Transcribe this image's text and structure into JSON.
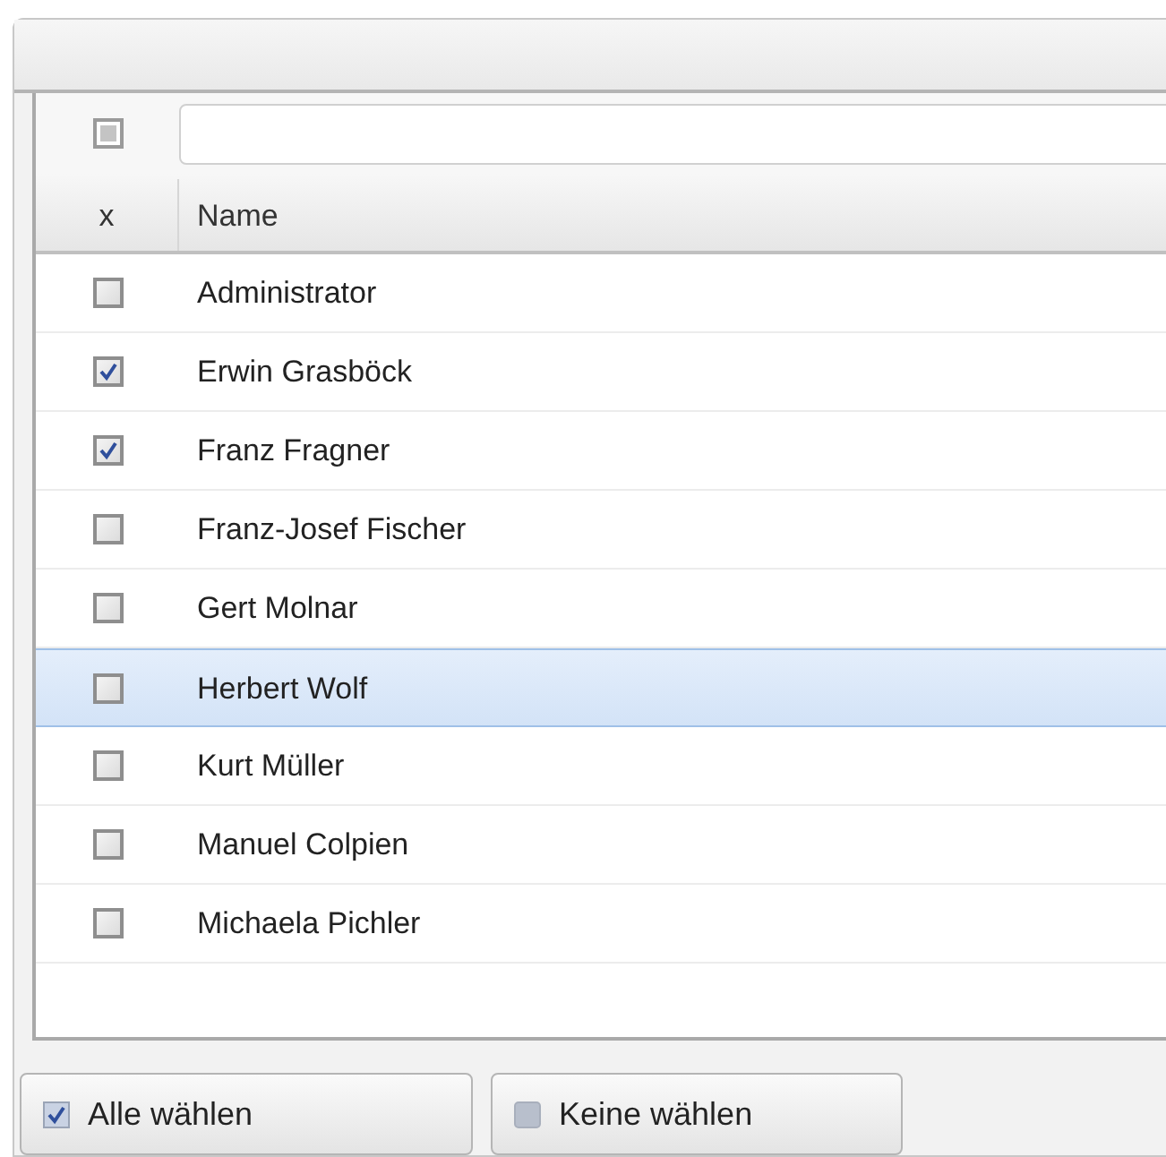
{
  "filter_row": {
    "checkbox": {
      "indeterminate": true
    }
  },
  "table": {
    "columns": [
      "x",
      "Name"
    ],
    "rows": [
      {
        "name": "Administrator",
        "checked": false,
        "selected": false
      },
      {
        "name": "Erwin Grasböck",
        "checked": true,
        "selected": false
      },
      {
        "name": "Franz Fragner",
        "checked": true,
        "selected": false
      },
      {
        "name": "Franz-Josef Fischer",
        "checked": false,
        "selected": false
      },
      {
        "name": "Gert Molnar",
        "checked": false,
        "selected": false
      },
      {
        "name": "Herbert Wolf",
        "checked": false,
        "selected": true
      },
      {
        "name": "Kurt Müller",
        "checked": false,
        "selected": false
      },
      {
        "name": "Manuel Colpien",
        "checked": false,
        "selected": false
      },
      {
        "name": "Michaela Pichler",
        "checked": false,
        "selected": false
      }
    ]
  },
  "buttons": [
    {
      "label": "Alle wählen",
      "kind": "check"
    },
    {
      "label": "Keine wählen",
      "kind": "square"
    }
  ]
}
